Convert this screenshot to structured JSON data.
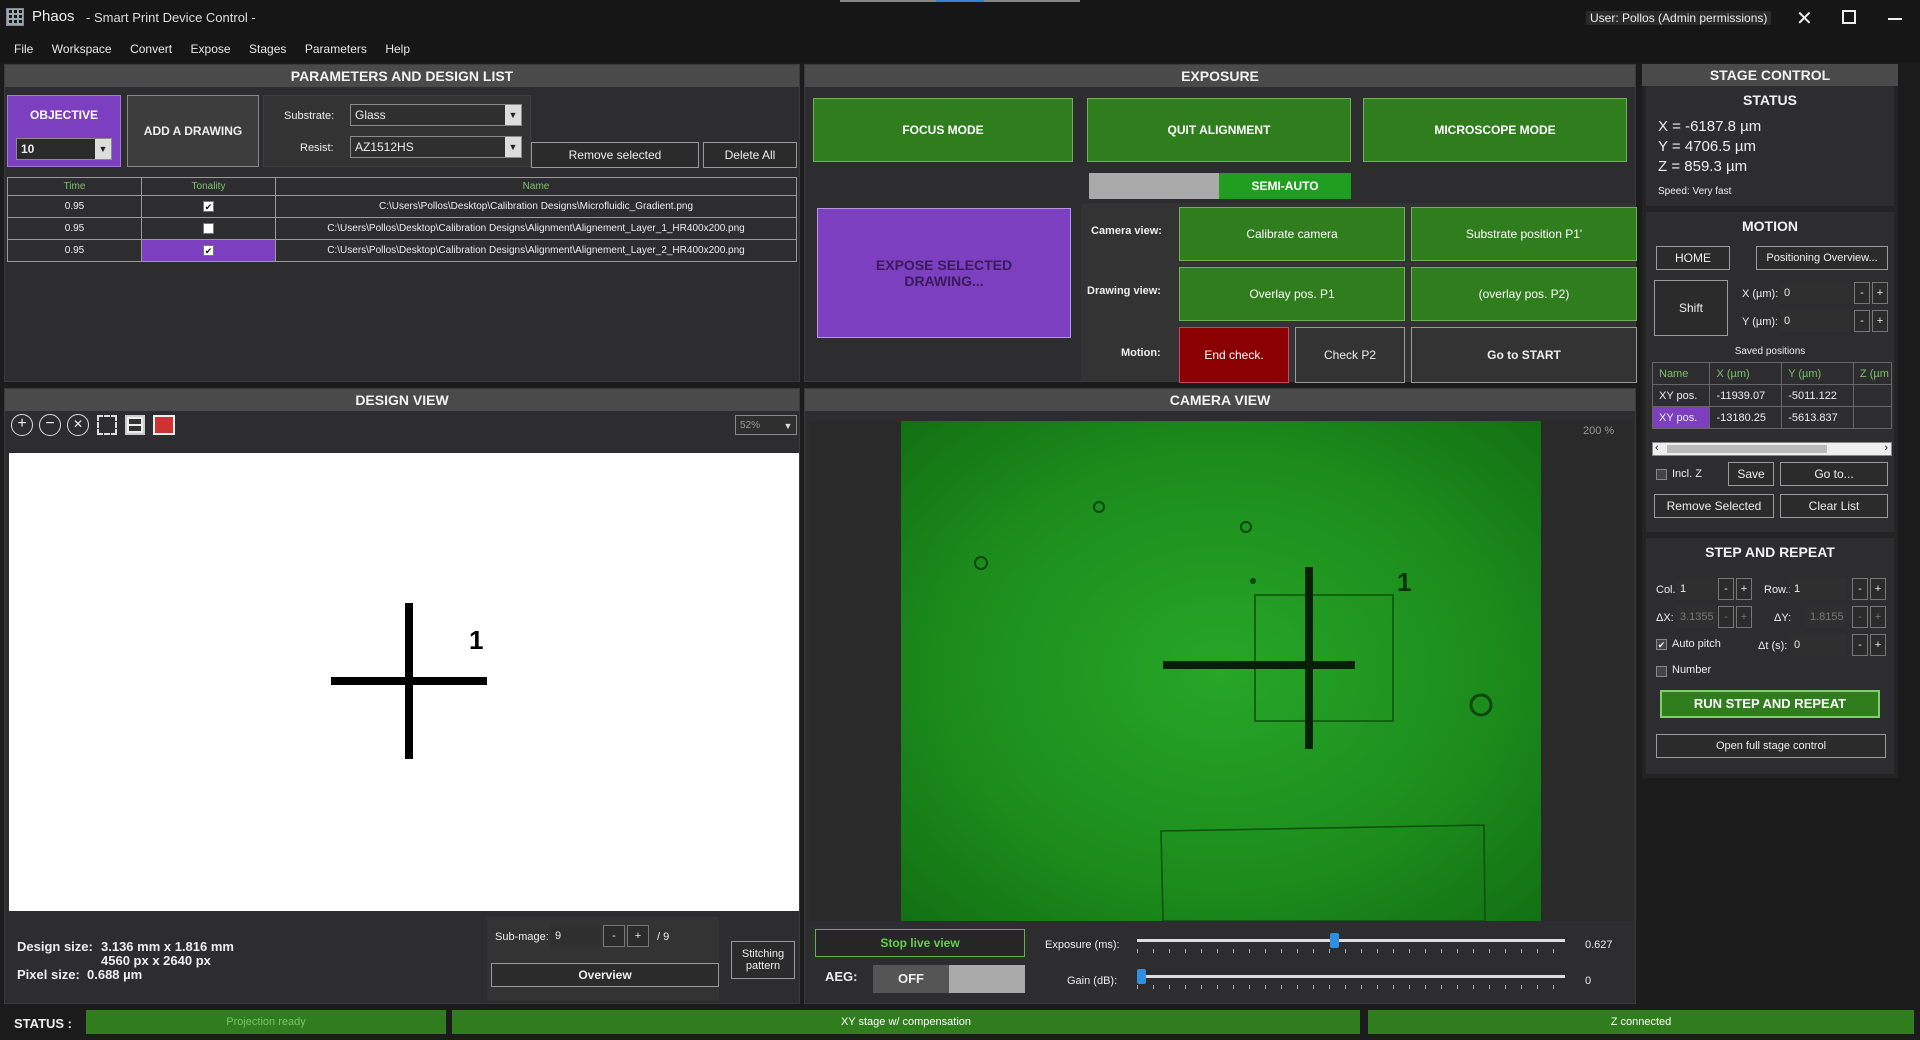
{
  "app": {
    "name": "Phaos",
    "title": "- Smart Print Device Control -",
    "user": "User: Pollos (Admin permissions)"
  },
  "menu": [
    "File",
    "Workspace",
    "Convert",
    "Expose",
    "Stages",
    "Parameters",
    "Help"
  ],
  "params": {
    "header": "PARAMETERS AND DESIGN LIST",
    "objective_label": "OBJECTIVE",
    "objective_value": "10",
    "add_drawing": "ADD A DRAWING",
    "substrate_label": "Substrate:",
    "substrate_value": "Glass",
    "resist_label": "Resist:",
    "resist_value": "AZ1512HS",
    "remove_selected": "Remove selected",
    "delete_all": "Delete All",
    "columns": [
      "Time",
      "Tonality",
      "Name"
    ],
    "rows": [
      {
        "time": "0.95",
        "checked": true,
        "selected": false,
        "name": "C:\\Users\\Pollos\\Desktop\\Calibration Designs\\Microfluidic_Gradient.png"
      },
      {
        "time": "0.95",
        "checked": false,
        "selected": false,
        "name": "C:\\Users\\Pollos\\Desktop\\Calibration Designs\\Alignment\\Alignement_Layer_1_HR400x200.png"
      },
      {
        "time": "0.95",
        "checked": true,
        "selected": true,
        "name": "C:\\Users\\Pollos\\Desktop\\Calibration Designs\\Alignment\\Alignement_Layer_2_HR400x200.png"
      }
    ]
  },
  "exposure": {
    "header": "EXPOSURE",
    "focus_mode": "FOCUS MODE",
    "quit_alignment": "QUIT ALIGNMENT",
    "microscope_mode": "MICROSCOPE MODE",
    "semi_auto": "SEMI-AUTO",
    "expose_selected": "EXPOSE SELECTED DRAWING...",
    "camera_view_label": "Camera view:",
    "calibrate_camera": "Calibrate camera",
    "substrate_position": "Substrate position P1'",
    "drawing_view_label": "Drawing view:",
    "overlay_p1": "Overlay pos. P1",
    "overlay_p2": "(overlay pos. P2)",
    "motion_label": "Motion:",
    "end_check": "End check.",
    "check_p2": "Check P2",
    "go_to_start": "Go to START"
  },
  "design_view": {
    "header": "DESIGN VIEW",
    "zoom": "52%",
    "marker_label": "1",
    "design_size_label": "Design size:",
    "design_size_mm": "3.136 mm x 1.816 mm",
    "design_size_px": "4560 px x 2640 px",
    "pixel_size_label": "Pixel size:",
    "pixel_size": "0.688 µm",
    "submage_label": "Sub-mage:",
    "submage_value": "9",
    "submage_total": "/ 9",
    "overview": "Overview",
    "stitching": "Stitching pattern",
    "colors": {
      "canvas": "#ffffff",
      "cross": "#000000"
    }
  },
  "camera_view": {
    "header": "CAMERA VIEW",
    "zoom": "200 %",
    "stop_live": "Stop live view",
    "aeg_label": "AEG:",
    "aeg_value": "OFF",
    "exposure_label": "Exposure (ms):",
    "exposure_value": "0.627",
    "exposure_fraction": 0.46,
    "gain_label": "Gain (dB):",
    "gain_value": "0",
    "gain_fraction": 0.0,
    "marker_label": "1",
    "colors": {
      "feed": "#1f9e1f"
    }
  },
  "stage": {
    "header": "STAGE CONTROL",
    "status_title": "STATUS",
    "x": "X = -6187.8 µm",
    "y": "Y = 4706.5 µm",
    "z": "Z = 859.3 µm",
    "speed": "Speed: Very fast",
    "motion_title": "MOTION",
    "home": "HOME",
    "positioning_overview": "Positioning Overview...",
    "shift": "Shift",
    "x_um_label": "X (µm):",
    "x_um_value": "0",
    "y_um_label": "Y (µm):",
    "y_um_value": "0",
    "saved_positions": "Saved positions",
    "saved_columns": [
      "Name",
      "X (µm)",
      "Y (µm)",
      "Z (µm"
    ],
    "saved_rows": [
      {
        "name": "XY pos.",
        "x": "-11939.07",
        "y": "-5011.122",
        "selected": false
      },
      {
        "name": "XY pos.",
        "x": "-13180.25",
        "y": "-5613.837",
        "selected": true
      }
    ],
    "incl_z": "Incl. Z",
    "save": "Save",
    "go_to": "Go to...",
    "remove_selected": "Remove Selected",
    "clear_list": "Clear List",
    "step_title": "STEP AND REPEAT",
    "col_label": "Col.:",
    "col_value": "1",
    "row_label": "Row.:",
    "row_value": "1",
    "dx_label": "ΔX:",
    "dx_value": "3.1355",
    "dy_label": "ΔY:",
    "dy_value": "1.8155",
    "auto_pitch": "Auto pitch",
    "dt_label": "Δt (s):",
    "dt_value": "0",
    "number": "Number",
    "run_step": "RUN STEP AND REPEAT",
    "open_full": "Open full stage control"
  },
  "status": {
    "label": "STATUS :",
    "projection": "Projection ready",
    "xy_stage": "XY stage w/ compensation",
    "z": "Z connected"
  },
  "colors": {
    "accent_green": "#2f7d1c",
    "accent_purple": "#7b3fbf",
    "alert_red": "#8b0000"
  }
}
